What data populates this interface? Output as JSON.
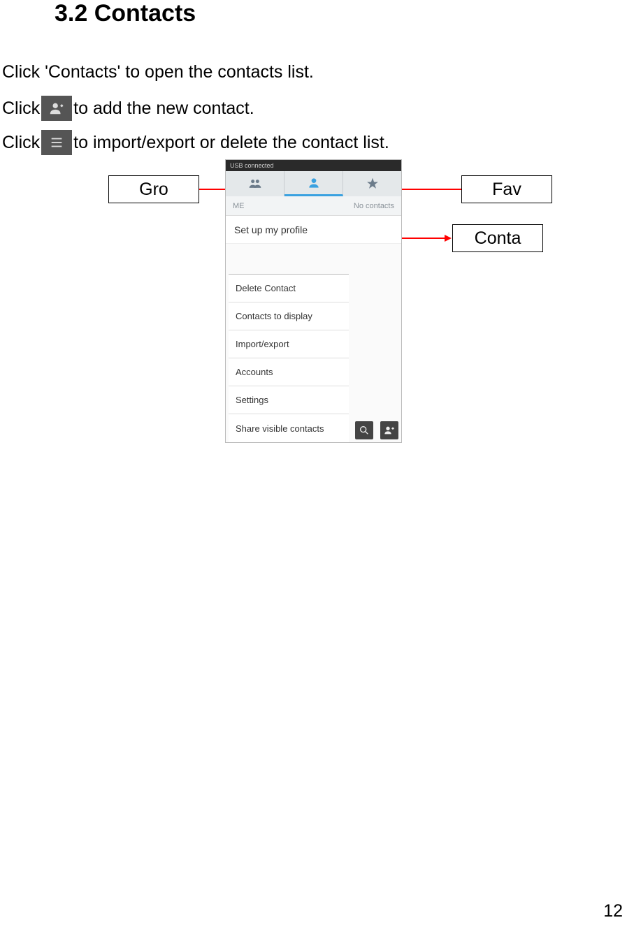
{
  "heading": "3.2 Contacts",
  "lines": {
    "l1": "Click 'Contacts' to open the contacts list.",
    "l2a": "Click ",
    "l2b": "to add the new contact.",
    "l3a": "Click ",
    "l3b": "to import/export or delete the contact list."
  },
  "callouts": {
    "gro": "Gro",
    "fav": "Fav",
    "conta": "Conta"
  },
  "screenshot": {
    "status": "USB connected",
    "sub_me": "ME",
    "sub_right": "No contacts",
    "profile": "Set up my profile",
    "menu": {
      "m1": "Delete Contact",
      "m2": "Contacts to display",
      "m3": "Import/export",
      "m4": "Accounts",
      "m5": "Settings",
      "m6": "Share visible contacts"
    }
  },
  "page_number": "12"
}
